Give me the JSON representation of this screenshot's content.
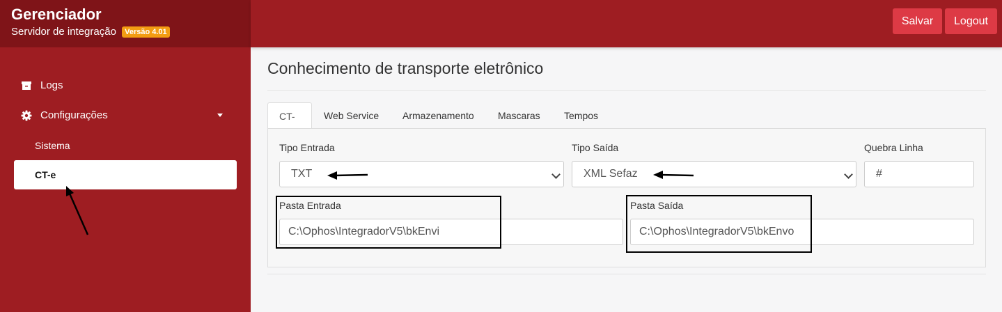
{
  "brand": {
    "title": "Gerenciador",
    "subtitle": "Servidor de integração",
    "version": "Versão 4.01"
  },
  "sidebar": {
    "items": [
      {
        "label": "Logs",
        "icon": "archive-icon"
      },
      {
        "label": "Configurações",
        "icon": "gear-icon",
        "expanded": true
      }
    ],
    "sub_items": [
      {
        "label": "Sistema"
      },
      {
        "label": "CT-e",
        "active": true
      }
    ]
  },
  "header": {
    "save_label": "Salvar",
    "logout_label": "Logout"
  },
  "page": {
    "title": "Conhecimento de transporte eletrônico"
  },
  "tabs": [
    {
      "label": "CT-e",
      "active": true
    },
    {
      "label": "Web Service"
    },
    {
      "label": "Armazenamento"
    },
    {
      "label": "Mascaras"
    },
    {
      "label": "Tempos"
    }
  ],
  "form": {
    "tipo_entrada": {
      "label": "Tipo Entrada",
      "value": "TXT"
    },
    "tipo_saida": {
      "label": "Tipo Saída",
      "value": "XML Sefaz"
    },
    "quebra_linha": {
      "label": "Quebra Linha",
      "value": "#"
    },
    "pasta_entrada": {
      "label": "Pasta Entrada",
      "value": "C:\\Ophos\\IntegradorV5\\bkEnvi"
    },
    "pasta_saida": {
      "label": "Pasta Saída",
      "value": "C:\\Ophos\\IntegradorV5\\bkEnvo"
    }
  },
  "colors": {
    "sidebar": "#9e1d22",
    "brand": "#7f1418",
    "button": "#dd3a45",
    "badge": "#f39c12"
  }
}
